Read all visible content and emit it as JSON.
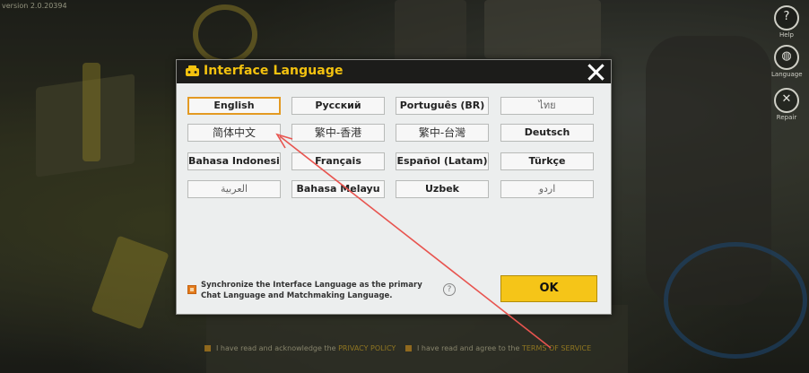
{
  "version_text": "version 2.0.20394",
  "side_icons": [
    {
      "icon": "help-icon",
      "label": "Help",
      "glyph": "?"
    },
    {
      "icon": "language-globe-icon",
      "label": "Language",
      "glyph": "◍"
    },
    {
      "icon": "repair-tools-icon",
      "label": "Repair",
      "glyph": "✕"
    }
  ],
  "agreement": {
    "text1": "I have read and acknowledge the",
    "link1": "PRIVACY POLICY",
    "text2": "I have read and agree to the",
    "link2": "TERMS OF SERVICE"
  },
  "dialog": {
    "title": "Interface Language",
    "title_icon": "controller-icon",
    "accent_color": "#f3c20f",
    "languages": [
      [
        "English",
        "Русский",
        "Português (BR)",
        "ไทย"
      ],
      [
        "简体中文",
        "繁中-香港",
        "繁中-台灣",
        "Deutsch"
      ],
      [
        "Bahasa Indonesia",
        "Français",
        "Español (Latam)",
        "Türkçe"
      ],
      [
        "العربية",
        "Bahasa Melayu",
        "Uzbek",
        "اردو"
      ]
    ],
    "selected": "English",
    "sync_text": "Synchronize the Interface Language as the primary Chat Language and Matchmaking Language.",
    "sync_checked": true,
    "help_glyph": "?",
    "ok_label": "OK"
  },
  "annotation_color": "#e8544f"
}
